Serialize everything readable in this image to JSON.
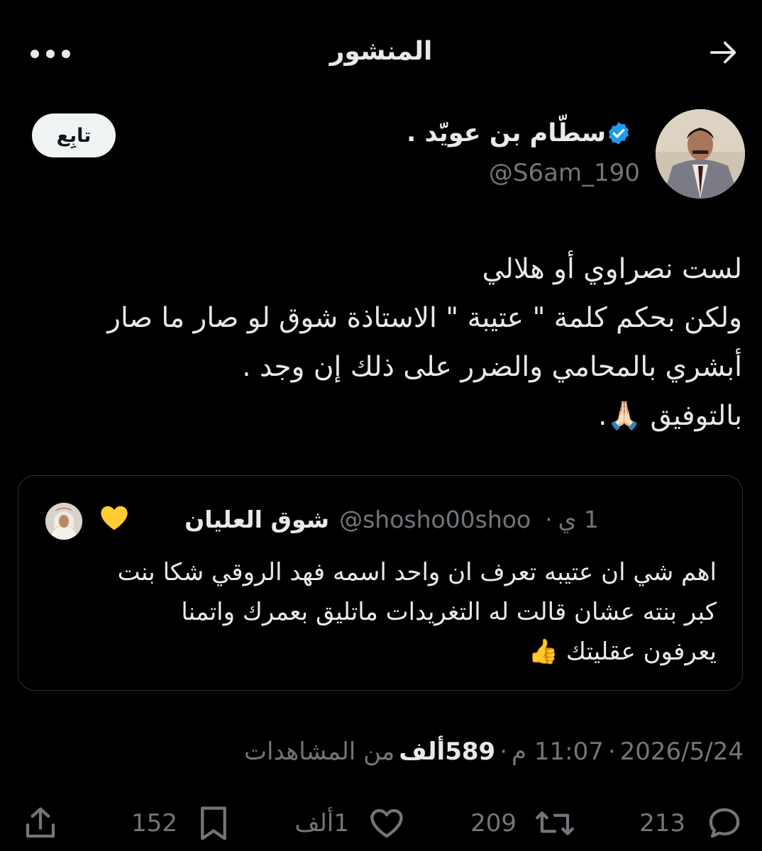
{
  "header": {
    "title": "المنشور",
    "back_icon": "arrow-right-icon",
    "more_icon": "more-dots-icon"
  },
  "author": {
    "display_name": "سطّام بن عويّد .",
    "handle": "@S6am_190",
    "verified": true,
    "follow_label": "تابِع"
  },
  "post": {
    "lines": [
      "لست نصراوي أو هلالي",
      "ولكن بحكم كلمة \" عتيبة \" الاستاذة شوق لو صار ما صار",
      "أبشري بالمحامي والضرر على ذلك إن وجد .",
      "بالتوفيق 🙏🏻."
    ]
  },
  "quote": {
    "name": "شوق العليان",
    "heart": "💛",
    "handle": "@shosho00shoo",
    "separator": "·",
    "time": "1 ي",
    "lines": [
      "اهم شي ان عتيبه تعرف ان واحد اسمه فهد الروقي شكا بنت",
      "كبر بنته عشان قالت له التغريدات ماتليق بعمرك واتمنا",
      "يعرفون عقليتك 👍"
    ]
  },
  "meta": {
    "date": "2026/5/24",
    "sep1": "·",
    "time": "11:07 م",
    "sep2": "·",
    "views_number": "589",
    "views_unit": "ألف",
    "views_label": "من المشاهدات"
  },
  "actions": {
    "replies": "213",
    "reposts": "209",
    "likes": "1ألف",
    "bookmarks": "152"
  },
  "colors": {
    "background": "#000000",
    "text": "#e7e9ea",
    "muted": "#71767b",
    "verified": "#1d9bf0"
  }
}
